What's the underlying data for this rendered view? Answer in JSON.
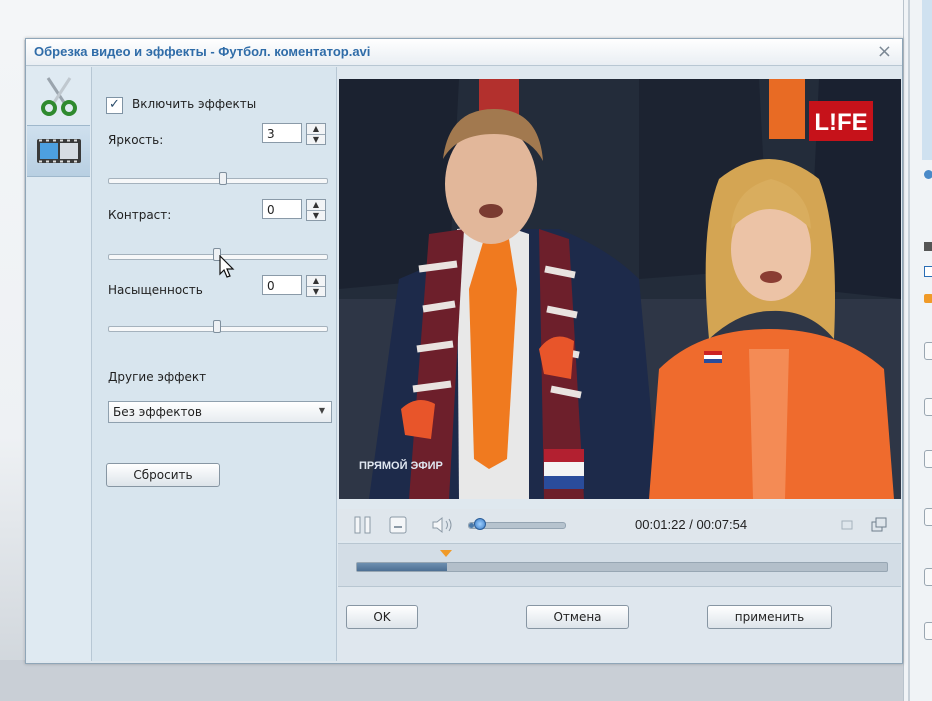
{
  "dialog": {
    "title": "Обрезка видео и эффекты - Футбол. коментатор.avi",
    "close_label": "×"
  },
  "tools": [
    {
      "icon": "scissors-icon",
      "active": false
    },
    {
      "icon": "film-effects-icon",
      "active": true
    }
  ],
  "effects": {
    "enable_label": "Включить эффекты",
    "enabled": true,
    "brightness": {
      "label": "Яркость:",
      "value": "3",
      "level": 0.53
    },
    "contrast": {
      "label": "Контраст:",
      "value": "0",
      "level": 0.5
    },
    "saturation": {
      "label": "Насыщенность",
      "value": "0",
      "level": 0.5
    },
    "other_label": "Другие эффект",
    "other_selected": "Без эффектов",
    "reset_label": "Сбросить"
  },
  "video": {
    "channel_logo": "L!FE",
    "live_caption": "ПРЯМОЙ ЭФИР"
  },
  "player": {
    "time": "00:01:22 / 00:07:54",
    "volume": 0.05,
    "timeline_marker": 0.17,
    "timeline_selection": 0.17
  },
  "buttons": {
    "ok": "OK",
    "cancel": "Отмена",
    "apply": "применить"
  },
  "colors": {
    "title": "#2f6ca8",
    "accent": "#f09a28",
    "dialog_bg": "#dfe8ef"
  }
}
